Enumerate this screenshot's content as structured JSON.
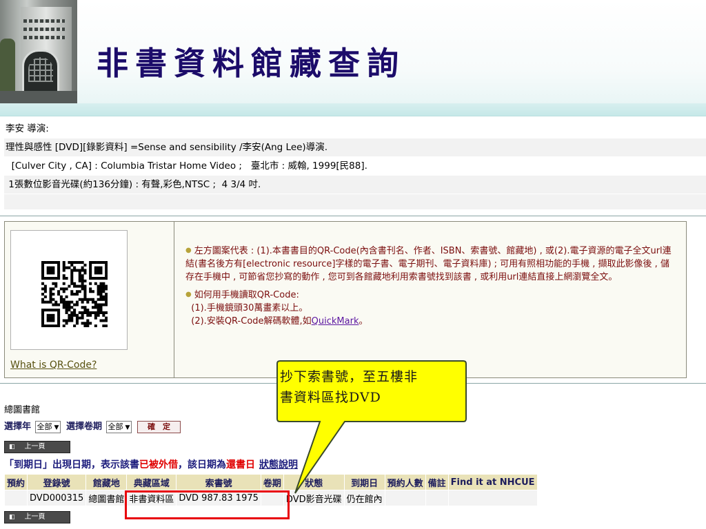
{
  "header": {
    "title": "非書資料館藏查詢"
  },
  "biblio": {
    "lines": [
      "李安 導演:",
      "理性與感性 [DVD][錄影資料] =Sense and sensibility /李安(Ang Lee)導演.",
      "  [Culver City , CA] : Columbia Tristar Home Video ;   臺北市 : 威翰, 1999[民88].",
      " 1張數位影音光碟(約136分鐘) : 有聲,彩色,NTSC ;  4 3/4 吋."
    ]
  },
  "qr": {
    "what_link": "What is QR-Code?",
    "para1": "左方圖案代表 : (1).本書書目的QR-Code(內含書刊名、作者、ISBN、索書號、館藏地) , 或(2).電子資源的電子全文url連結(書名後方有[electronic resource]字樣的電子書、電子期刊、電子資料庫) ; 可用有照相功能的手機 , 擷取此影像後 , 儲存在手機中 , 可節省您抄寫的動作 , 您可到各館藏地利用索書號找到該書 , 或利用url連結直接上網瀏覽全文。",
    "para2_title": "如何用手機讀取QR-Code:",
    "para2_line1": "(1).手機鏡頭30萬畫素以上。",
    "para2_line2_prefix": "(2).安裝QR-Code解碼軟體,如",
    "para2_link": "QuickMark",
    "para2_line2_suffix": "。"
  },
  "holdings": {
    "library": "總圖書館",
    "year_label": "選擇年",
    "year_value": "全部",
    "volume_label": "選擇卷期",
    "volume_value": "全部",
    "confirm_label": "確　定",
    "prev_page": "上一頁",
    "note_prefix": "「到期日」出現日期，表示該書",
    "note_red1": "已被外借",
    "note_mid": "，該日期為",
    "note_red2": "還書日",
    "note_link": "狀態說明",
    "columns": [
      "預約",
      "登錄號",
      "館藏地",
      "典藏區域",
      "索書號",
      "卷期",
      "狀態",
      "到期日",
      "預約人數",
      "備註",
      "Find it at NHCUE"
    ],
    "rows": [
      [
        "",
        "DVD000315",
        "總圖書館",
        "非書資料區",
        "DVD 987.83 1975",
        "",
        "DVD影音光碟",
        "仍在館內",
        "",
        "",
        ""
      ]
    ]
  },
  "annotation": {
    "callout_line1": "抄下索書號，至五樓非",
    "callout_line2": "書資料區找DVD",
    "callout_fill": "#ffff00",
    "callout_stroke": "#3a4a2a",
    "highlight_color": "#e8000a"
  }
}
